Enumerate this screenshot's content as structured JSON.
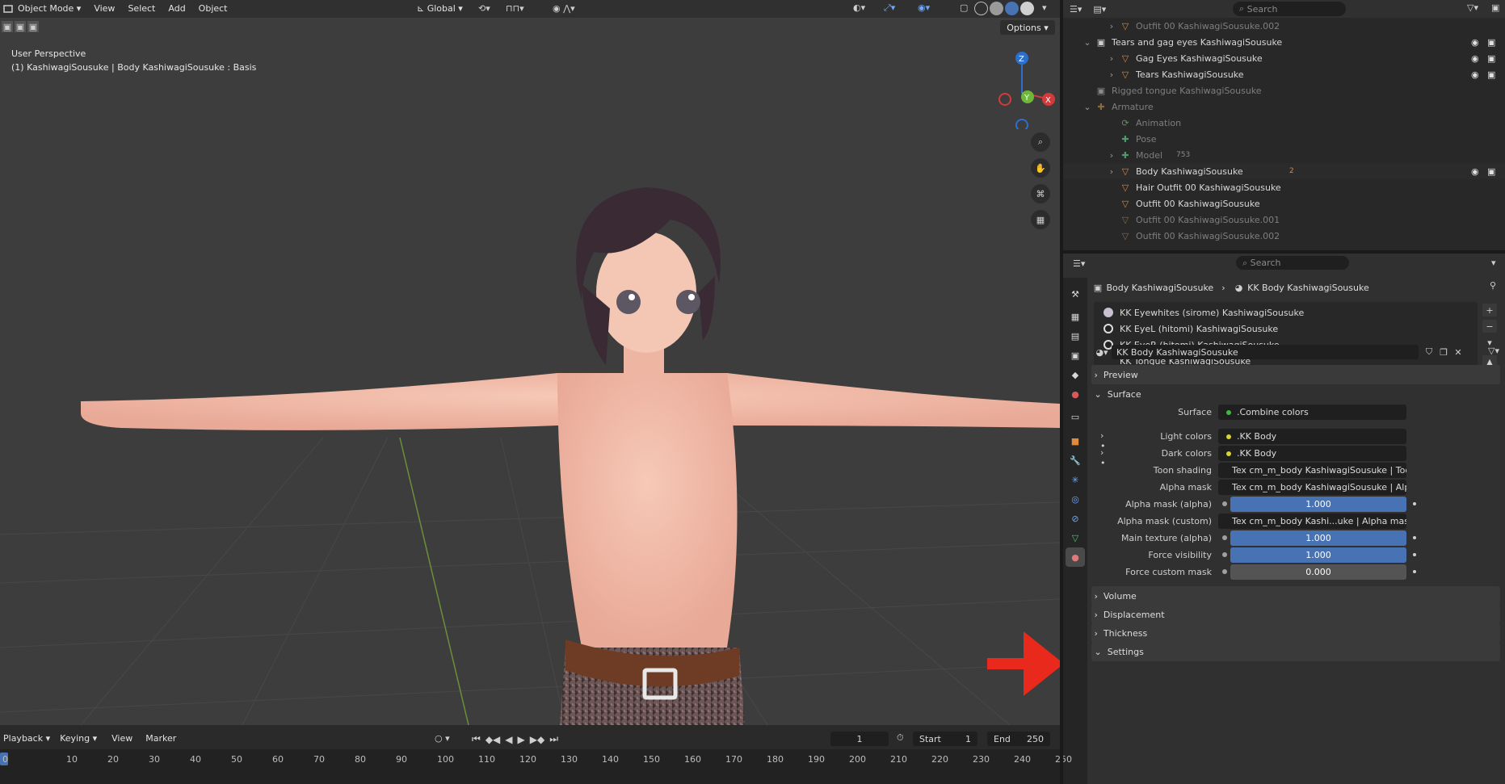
{
  "topbar": {
    "mode": "Object Mode",
    "menus": [
      "View",
      "Select",
      "Add",
      "Object"
    ],
    "transform_orientation": "Global",
    "options_label": "Options"
  },
  "viewport": {
    "perspective": "User Perspective",
    "active_object": "(1) KashiwagiSousuke | Body KashiwagiSousuke : Basis",
    "gizmo": {
      "z": "Z",
      "x": "X",
      "y": "Y"
    }
  },
  "outliner": {
    "search_placeholder": "Search",
    "rows": [
      {
        "label": "Outfit 00 KashiwagiSousuke.002",
        "dim": true
      },
      {
        "label": "Tears and gag eyes KashiwagiSousuke",
        "dim": false
      },
      {
        "label": "Gag Eyes KashiwagiSousuke",
        "dim": false
      },
      {
        "label": "Tears KashiwagiSousuke",
        "dim": false
      },
      {
        "label": "Rigged tongue KashiwagiSousuke",
        "dim": true
      },
      {
        "label": "Armature",
        "dim": true
      },
      {
        "label": "Animation",
        "dim": true
      },
      {
        "label": "Pose",
        "dim": true
      },
      {
        "label": "Model",
        "dim": true
      },
      {
        "label": "Body KashiwagiSousuke",
        "dim": false
      },
      {
        "label": "Hair Outfit 00 KashiwagiSousuke",
        "dim": false
      },
      {
        "label": "Outfit 00 KashiwagiSousuke",
        "dim": false
      },
      {
        "label": "Outfit 00 KashiwagiSousuke.001",
        "dim": true
      },
      {
        "label": "Outfit 00 KashiwagiSousuke.002",
        "dim": true
      }
    ],
    "model_count": "753",
    "body_badge": "2"
  },
  "properties": {
    "search_placeholder": "Search",
    "breadcrumb_object": "Body KashiwagiSousuke",
    "breadcrumb_material": "KK Body KashiwagiSousuke",
    "material_slots": [
      {
        "label": "KK Eyewhites (sirome) KashiwagiSousuke",
        "selected": false
      },
      {
        "label": "KK EyeL (hitomi) KashiwagiSousuke",
        "selected": false
      },
      {
        "label": "KK EyeR (hitomi) KashiwagiSousuke",
        "selected": false
      },
      {
        "label": "KK Tongue KashiwagiSousuke",
        "selected": false
      },
      {
        "label": "KK Body KashiwagiSousuke",
        "selected": true
      }
    ],
    "material_name": "KK Body KashiwagiSousuke",
    "panels": {
      "preview": "Preview",
      "surface": "Surface",
      "volume": "Volume",
      "displacement": "Displacement",
      "thickness": "Thickness",
      "settings": "Settings"
    },
    "surface_rows": [
      {
        "label": "Surface",
        "kind": "link",
        "value": ".Combine colors",
        "dot": "#3fb83f"
      },
      {
        "label": "Light colors",
        "kind": "link",
        "value": ".KK Body",
        "dot": "#d6d62e"
      },
      {
        "label": "Dark colors",
        "kind": "link",
        "value": ".KK Body",
        "dot": "#d6d62e"
      },
      {
        "label": "Toon shading",
        "kind": "link",
        "value": "Tex cm_m_body KashiwagiSousuke | Toon sh...",
        "dot": "#d6d62e"
      },
      {
        "label": "Alpha mask",
        "kind": "link",
        "value": "Tex cm_m_body KashiwagiSousuke | Alpha m...",
        "dot": "#d6d62e"
      },
      {
        "label": "Alpha mask (alpha)",
        "kind": "slider",
        "value": "1.000",
        "fraction": 1.0
      },
      {
        "label": "Alpha mask (custom)",
        "kind": "link",
        "value": "Tex cm_m_body Kashi...uke | Alpha mask (SFW)",
        "dot": "#d6d62e"
      },
      {
        "label": "Main texture (alpha)",
        "kind": "slider",
        "value": "1.000",
        "fraction": 1.0
      },
      {
        "label": "Force visibility",
        "kind": "slider",
        "value": "1.000",
        "fraction": 1.0
      },
      {
        "label": "Force custom mask",
        "kind": "slider",
        "value": "0.000",
        "fraction": 0.0
      }
    ],
    "accent": "#4772b3"
  },
  "timeline": {
    "menus": [
      "Playback",
      "Keying",
      "View",
      "Marker"
    ],
    "current_frame": "1",
    "start_label": "Start",
    "start_value": "1",
    "end_label": "End",
    "end_value": "250",
    "ruler": [
      "0",
      "10",
      "20",
      "30",
      "40",
      "50",
      "60",
      "70",
      "80",
      "90",
      "100",
      "110",
      "120",
      "130",
      "140",
      "150",
      "160",
      "170",
      "180",
      "190",
      "200",
      "210",
      "220",
      "230",
      "240",
      "250"
    ]
  },
  "annotation": {
    "arrow_color": "#e8291c"
  }
}
